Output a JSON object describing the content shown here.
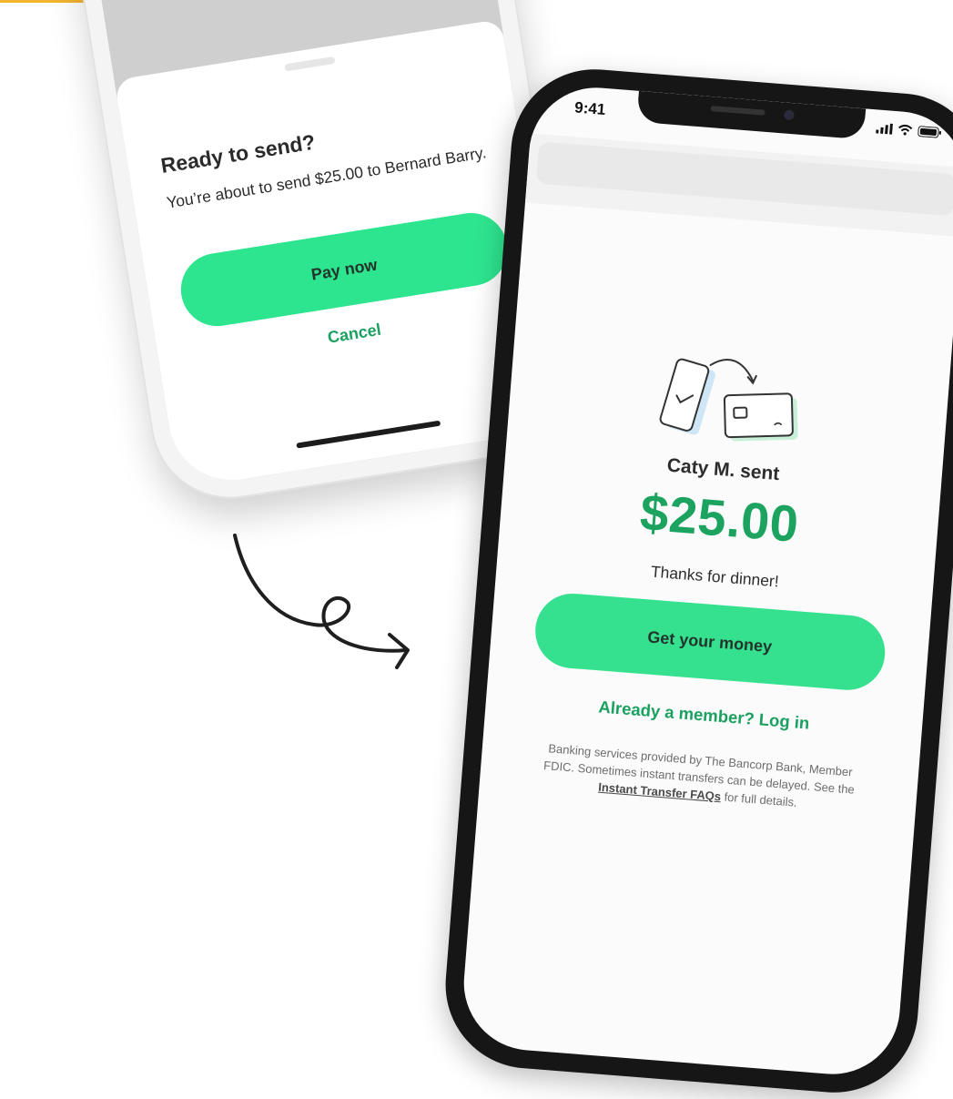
{
  "colors": {
    "accent_line": "#f2b42e",
    "primary_green": "#2ee58f",
    "link_green": "#1aa060",
    "amount_green": "#1ca35f"
  },
  "confirm_sheet": {
    "title": "Ready to send?",
    "description": "You’re about to send $25.00 to Bernard Barry.",
    "pay_button": "Pay now",
    "cancel_button": "Cancel"
  },
  "receive_screen": {
    "status_bar": {
      "time": "9:41",
      "icons": [
        "signal-icon",
        "wifi-icon",
        "battery-icon"
      ]
    },
    "illustration_icon": "phone-to-card-icon",
    "sender_text": "Caty M. sent",
    "amount": "$25.00",
    "memo": "Thanks for dinner!",
    "primary_button": "Get your money",
    "login_link": "Already a member? Log in",
    "disclaimer": {
      "part1": "Banking services provided by The Bancorp Bank, Member FDIC. Sometimes instant transfers can be delayed. See the",
      "faq_link": "Instant Transfer FAQs",
      "part2": "for full details."
    }
  },
  "decor": {
    "arrow_icon": "curvy-arrow-icon"
  }
}
